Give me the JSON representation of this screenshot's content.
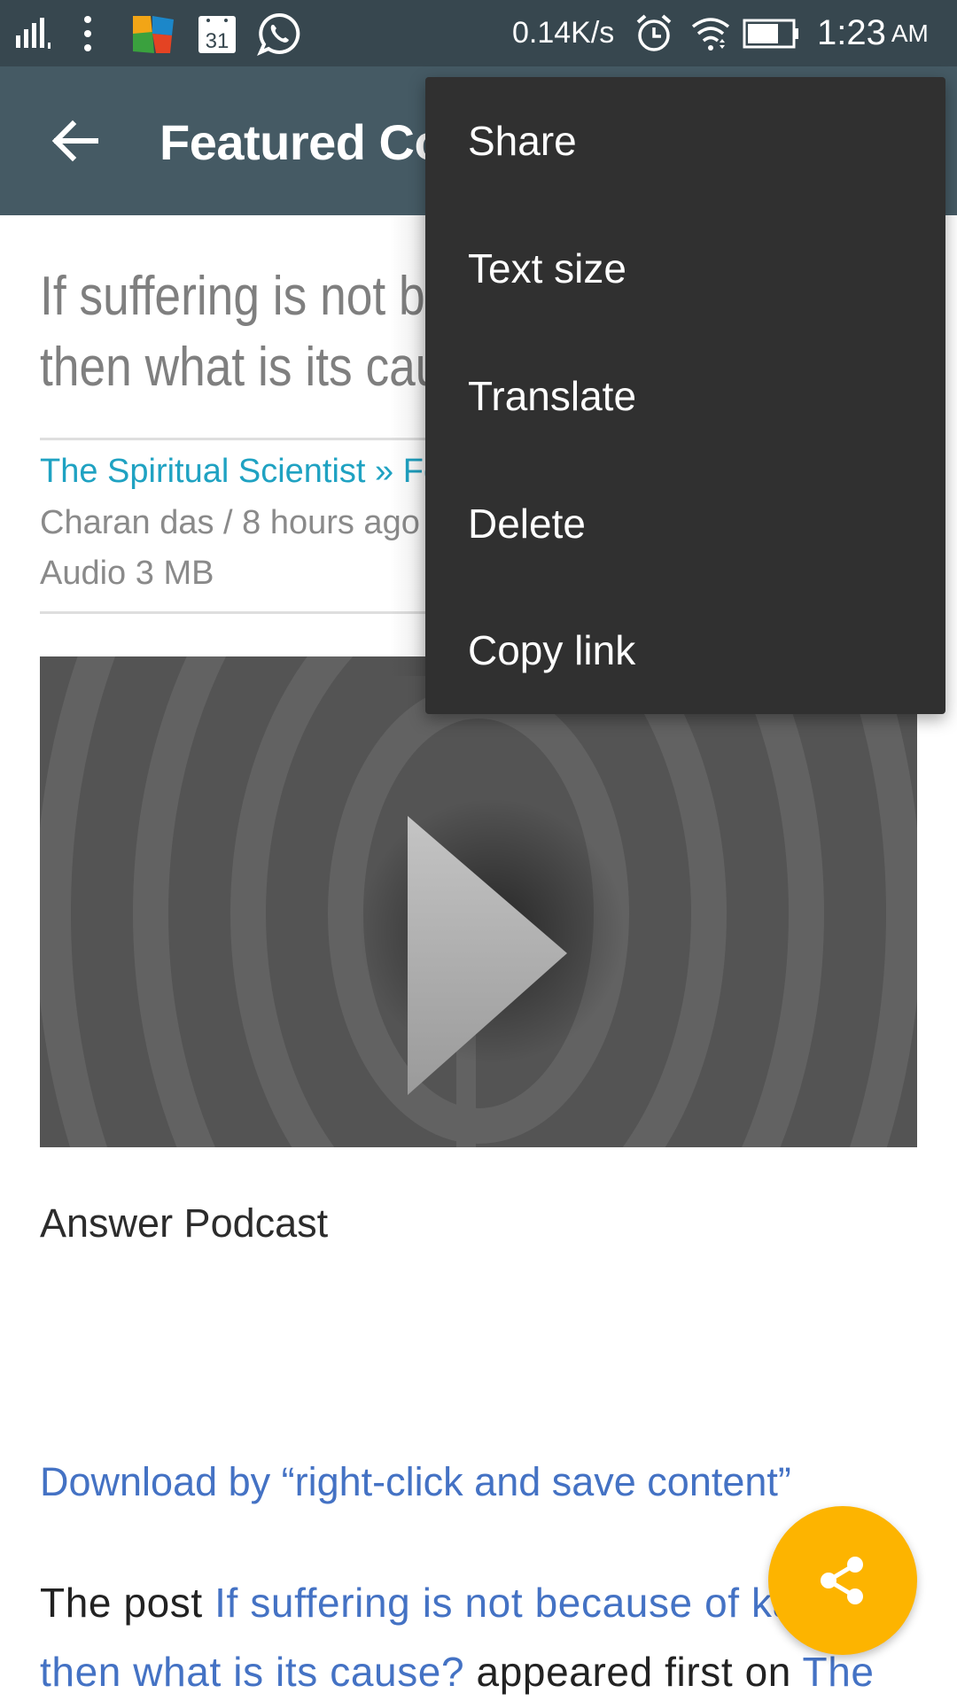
{
  "status_bar": {
    "network_speed": "0.14K/s",
    "time": "1:23",
    "ampm": "AM",
    "calendar_day": "31",
    "icons": [
      "signal-icon",
      "more-dots-icon",
      "avg-antivirus-icon",
      "calendar-icon",
      "whatsapp-icon",
      "alarm-icon",
      "wifi-icon",
      "battery-icon"
    ]
  },
  "app_bar": {
    "title": "Featured Content",
    "back_icon": "arrow-left-icon"
  },
  "article": {
    "title_lines": [
      "If suffering is not because of karma,",
      "then what is its cause?"
    ],
    "category": "The Spiritual Scientist » Featured",
    "author_time": "Charan das / 8 hours ago",
    "media_info": "Audio 3 MB",
    "image_icon": "play-icon",
    "caption": "Answer Podcast",
    "download_link": "Download by “right-click and save content”",
    "footer": {
      "prefix": "The post ",
      "link_text_line1": "If suffering is not because of karma,",
      "link_text_line2": "then what is its cause?",
      "middle": " appeared first on ",
      "site_link": "The"
    }
  },
  "menu": {
    "items": [
      {
        "label": "Share"
      },
      {
        "label": "Text size"
      },
      {
        "label": "Translate"
      },
      {
        "label": "Delete"
      },
      {
        "label": "Copy link"
      }
    ]
  },
  "fab": {
    "icon": "share-icon",
    "color": "#FDB400"
  },
  "colors": {
    "status_bar": "#37474F",
    "app_bar": "#455A64",
    "menu_bg": "#303030",
    "category_link": "#1FA2C2",
    "body_link": "#4472C4"
  }
}
